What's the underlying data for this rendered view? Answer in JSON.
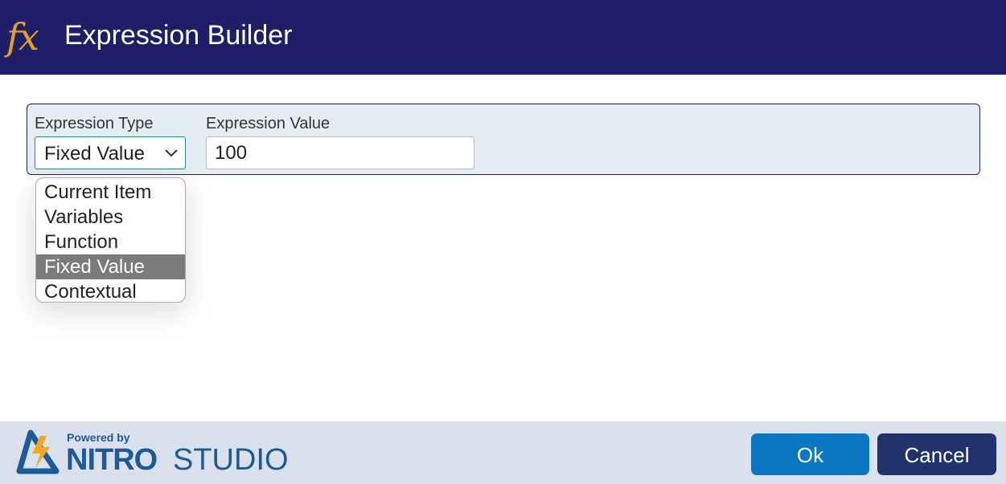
{
  "header": {
    "icon": "fx",
    "title": "Expression Builder"
  },
  "form": {
    "type_label": "Expression Type",
    "type_value": "Fixed Value",
    "value_label": "Expression Value",
    "value": "100",
    "options": [
      "Current Item",
      "Variables",
      "Function",
      "Fixed Value",
      "Contextual"
    ],
    "selected_option": "Fixed Value"
  },
  "footer": {
    "powered_by": "Powered by",
    "brand_bold": "NITRO",
    "brand_light": "STUDIO",
    "ok_label": "Ok",
    "cancel_label": "Cancel"
  },
  "colors": {
    "header": "#1f1f69",
    "ok": "#0b77c2",
    "cancel": "#20346b",
    "fx": "#e0a12a"
  }
}
